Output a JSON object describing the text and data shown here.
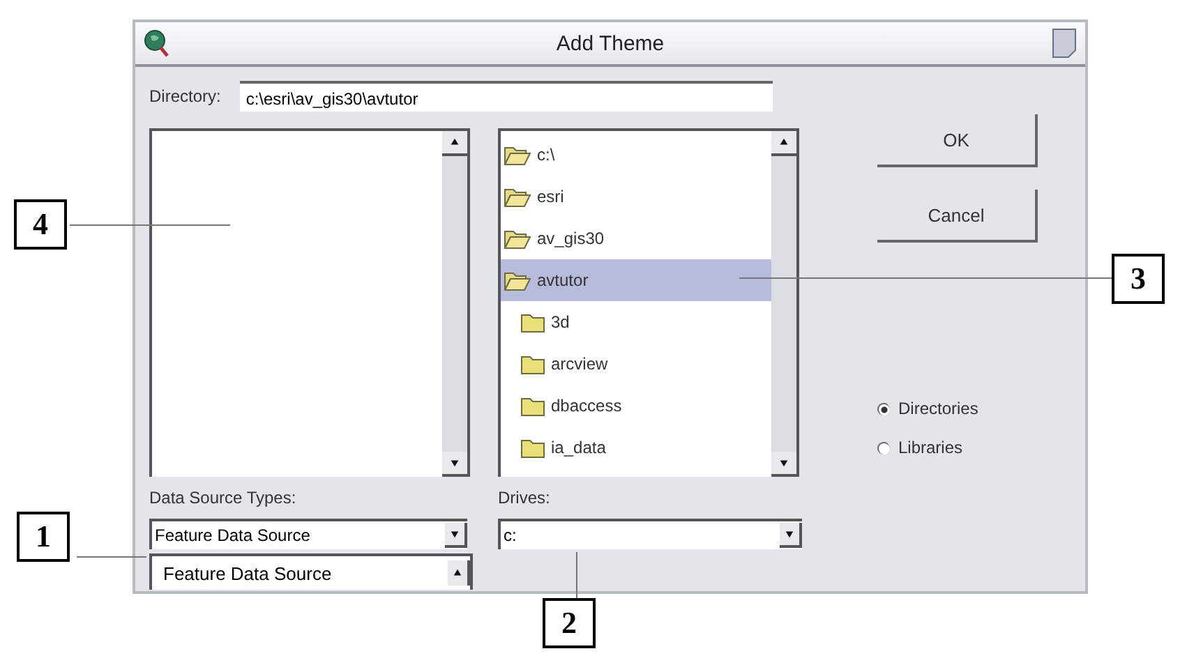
{
  "window": {
    "title": "Add Theme"
  },
  "directory": {
    "label": "Directory:",
    "value": "c:\\esri\\av_gis30\\avtutor"
  },
  "folders": [
    {
      "name": "c:\\",
      "open": true,
      "selected": false
    },
    {
      "name": "esri",
      "open": true,
      "selected": false
    },
    {
      "name": "av_gis30",
      "open": true,
      "selected": false
    },
    {
      "name": "avtutor",
      "open": true,
      "selected": true,
      "children": [
        {
          "name": "3d",
          "open": false,
          "selected": false
        },
        {
          "name": "arcview",
          "open": false,
          "selected": false
        },
        {
          "name": "dbaccess",
          "open": false,
          "selected": false
        },
        {
          "name": "ia_data",
          "open": false,
          "selected": false
        }
      ]
    }
  ],
  "data_source_types": {
    "label": "Data Source Types:",
    "value": "Feature Data Source",
    "open_list": [
      "Feature Data Source"
    ]
  },
  "drives": {
    "label": "Drives:",
    "value": "c:"
  },
  "buttons": [
    "OK",
    "Cancel"
  ],
  "source_options": [
    {
      "label": "Directories",
      "selected": true
    },
    {
      "label": "Libraries",
      "selected": false
    }
  ],
  "callouts": [
    {
      "number": "4"
    },
    {
      "number": "3"
    },
    {
      "number": "1"
    },
    {
      "number": "2"
    }
  ]
}
